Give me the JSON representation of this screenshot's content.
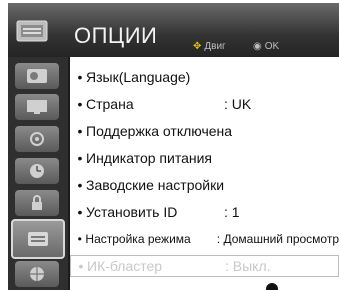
{
  "header": {
    "title": "ОПЦИИ",
    "hint_move_glyph": "✥",
    "hint_move": "Двиг",
    "hint_ok_glyph": "◉",
    "hint_ok": "OK"
  },
  "sidebar": {
    "items": [
      {
        "icon": "picture-icon"
      },
      {
        "icon": "screen-icon"
      },
      {
        "icon": "audio-icon"
      },
      {
        "icon": "clock-icon"
      },
      {
        "icon": "lock-icon"
      },
      {
        "icon": "options-icon",
        "active": true
      },
      {
        "icon": "network-icon"
      }
    ]
  },
  "menu": {
    "items": [
      {
        "bullet": "•",
        "label": "Язык(Language)",
        "value": ""
      },
      {
        "bullet": "•",
        "label": "Страна",
        "value": ": UK"
      },
      {
        "bullet": "•",
        "label": "Поддержка отключена",
        "value": ""
      },
      {
        "bullet": "•",
        "label": "Индикатор питания",
        "value": ""
      },
      {
        "bullet": "•",
        "label": "Заводские настройки",
        "value": ""
      },
      {
        "bullet": "•",
        "label": "Установить ID",
        "value": ": 1"
      },
      {
        "bullet": "•",
        "label": "Настройка режима",
        "value": ": Домашний просмотр"
      },
      {
        "bullet": "•",
        "label": "ИК-бластер",
        "value": ": Выкл."
      }
    ]
  },
  "colors": {
    "header_bg": "#333333",
    "sidebar_bg": "#2f2f2f",
    "panel_bg": "#ffffff",
    "disabled_text": "#c8c8c8",
    "hint_accent": "#e6c200"
  }
}
